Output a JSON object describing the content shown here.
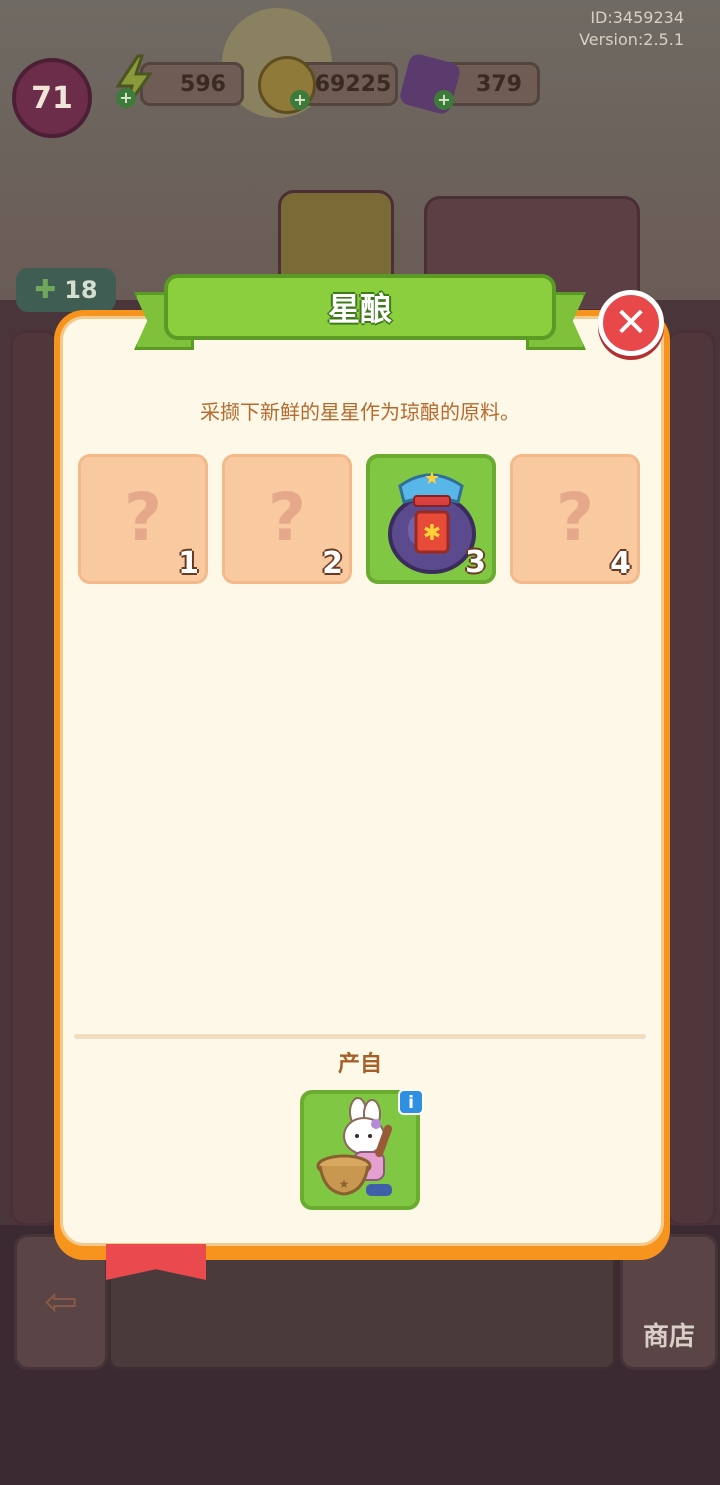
{
  "hud": {
    "player_id": "ID:3459234",
    "version": "Version:2.5.1",
    "level": "71",
    "energy": "596",
    "coins": "69225",
    "gems": "379",
    "energy_icon": "lightning-icon",
    "coin_icon": "coin-icon",
    "gem_icon": "gem-icon"
  },
  "background": {
    "badge_count": "18",
    "shop_label": "商店"
  },
  "dialog": {
    "title": "星酿",
    "description": "采撷下新鲜的星星作为琼酿的原料。",
    "close_icon": "close-icon",
    "slots": [
      {
        "number": "1",
        "state": "unknown",
        "symbol": "?"
      },
      {
        "number": "2",
        "state": "unknown",
        "symbol": "?"
      },
      {
        "number": "3",
        "state": "unlocked",
        "item": "star-wine-jar"
      },
      {
        "number": "4",
        "state": "unknown",
        "symbol": "?"
      }
    ],
    "source_label": "产自",
    "source_item": "bunny-with-basket",
    "info_symbol": "i"
  },
  "colors": {
    "dialog_border": "#f7941d",
    "dialog_bg": "#fdf8e8",
    "banner_green": "#8bcf3f",
    "slot_locked": "#f9caa0",
    "slot_active": "#80c743",
    "close_red": "#e8484a",
    "text_brown": "#b86a2e"
  }
}
